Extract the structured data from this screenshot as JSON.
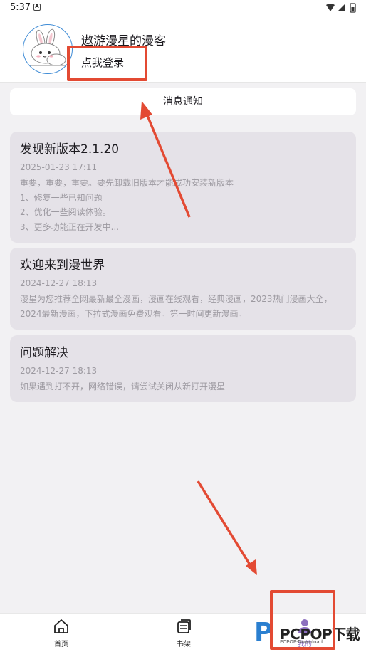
{
  "status_bar": {
    "time": "5:37",
    "app_icon_letter": "A"
  },
  "profile": {
    "username": "遨游漫星的漫客",
    "login_label": "点我登录",
    "avatar_icon": "bunny-avatar"
  },
  "notice_button": {
    "label": "消息通知"
  },
  "announcements": [
    {
      "title": "发现新版本2.1.20",
      "date": "2025-01-23 17:11",
      "lines": [
        "重要，重要，重要。要先卸载旧版本才能成功安装新版本",
        "1、修复一些已知问题",
        "2、优化一些阅读体验。",
        "3、更多功能正在开发中..."
      ]
    },
    {
      "title": "欢迎来到漫世界",
      "date": "2024-12-27 18:13",
      "lines": [
        "漫星为您推荐全网最新最全漫画，漫画在线观看，经典漫画，2023热门漫画大全，",
        "2024最新漫画，下拉式漫画免费观看。第一时间更新漫画。"
      ]
    },
    {
      "title": "问题解决",
      "date": "2024-12-27 18:13",
      "lines": [
        "如果遇到打不开，网络错误，请尝试关闭从新打开漫星"
      ]
    }
  ],
  "bottom_nav": {
    "items": [
      {
        "label": "首页",
        "icon": "home-icon"
      },
      {
        "label": "书架",
        "icon": "bookshelf-icon"
      },
      {
        "label": "我的",
        "icon": "profile-icon",
        "active": true
      }
    ]
  },
  "watermark": {
    "letter": "P",
    "brand": "PCPOP下载",
    "sub": "PCPOP·Download"
  },
  "colors": {
    "accent": "#8c6fbf",
    "annotation": "#e34a33",
    "card_bg": "#e5e2e8",
    "page_bg": "#f2f1f3"
  }
}
